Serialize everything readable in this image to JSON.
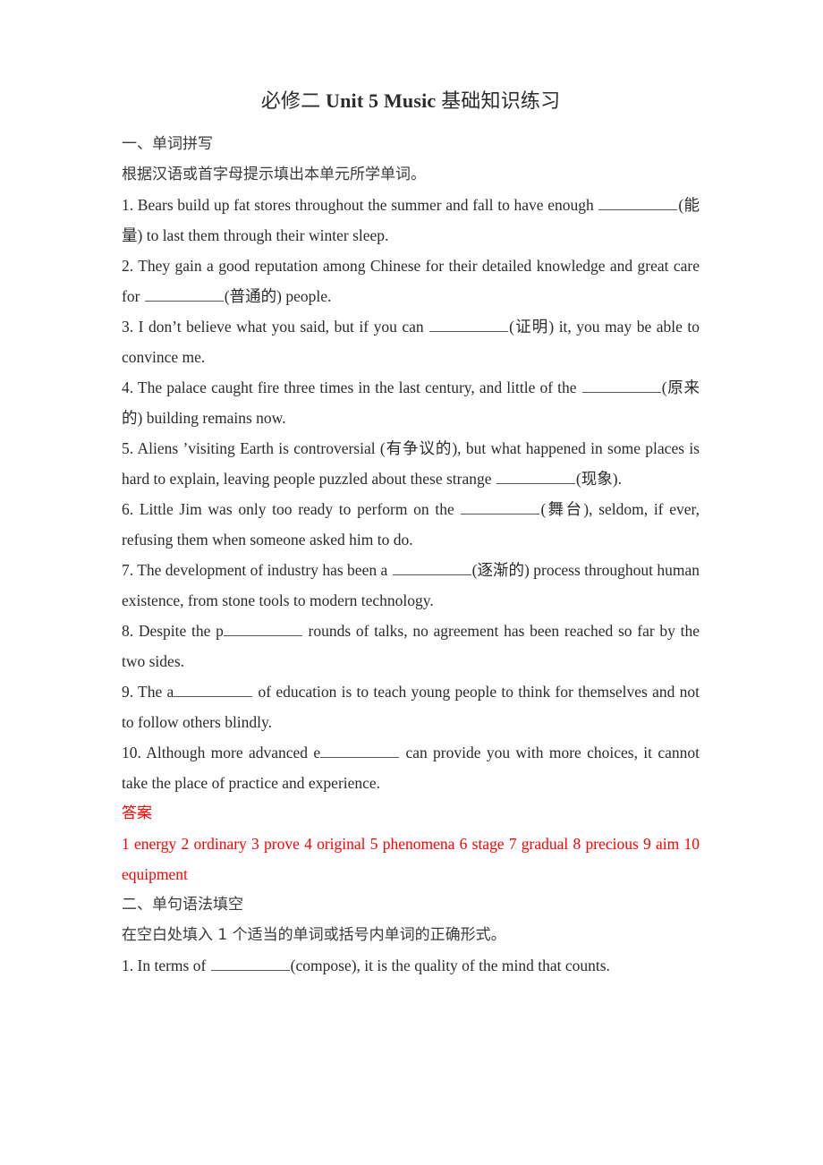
{
  "document": {
    "title": {
      "cn_prefix": "必修二 ",
      "en_bold": "Unit 5 Music",
      "cn_suffix": " 基础知识练习"
    },
    "colors": {
      "text": "#2b2b2b",
      "answer_red": "#FF0000"
    }
  },
  "section_one": {
    "heading": "一、单词拼写",
    "instruction": "根据汉语或首字母提示填出本单元所学单词。",
    "questions": [
      {
        "number": "1.",
        "pre": " Bears build up fat stores throughout the summer and fall to have enough ",
        "hint": "(能量)",
        "post": " to last them through their winter sleep."
      },
      {
        "number": "2.",
        "pre": " They gain a good reputation among Chinese for their detailed knowledge and great care for ",
        "hint": "(普通的)",
        "post": " people."
      },
      {
        "number": "3.",
        "pre": " I don’t believe what you said, but if you can ",
        "hint": "(证明)",
        "post": " it, you may be able to convince me."
      },
      {
        "number": "4.",
        "pre": " The palace caught fire three times in the last century, and little of the ",
        "hint": "(原来的)",
        "post": " building remains now."
      },
      {
        "number": "5.",
        "pre": " Aliens ’visiting Earth is controversial (有争议的), but what happened in some places is hard to explain, leaving people puzzled about these strange ",
        "hint": "(现象)",
        "post": "."
      },
      {
        "number": "6.",
        "pre": " Little Jim was only too ready to perform on the ",
        "hint": "(舞台)",
        "post": ", seldom, if ever, refusing them when someone asked him to do."
      },
      {
        "number": "7.",
        "pre": " The development of industry has been a ",
        "hint": "(逐渐的)",
        "post": " process throughout human existence, from stone tools to modern technology."
      },
      {
        "number": "8.",
        "pre": " Despite the p",
        "hint": "",
        "post": " rounds of talks, no agreement has been reached so far by the two sides."
      },
      {
        "number": "9.",
        "pre": " The a",
        "hint": "",
        "post": " of education is to teach young people to think for themselves and not to follow others blindly."
      },
      {
        "number": "10.",
        "pre": " Although more advanced e",
        "hint": "",
        "post": " can provide you with more choices, it cannot take the place of practice and experience."
      }
    ],
    "answers": {
      "label": "答案",
      "text": "1 energy 2 ordinary 3 prove 4 original 5 phenomena 6 stage 7 gradual 8 precious 9 aim 10 equipment"
    }
  },
  "section_two": {
    "heading": "二、单句语法填空",
    "instruction": "在空白处填入 1 个适当的单词或括号内单词的正确形式。",
    "questions": [
      {
        "number": "1.",
        "pre": " In terms of ",
        "hint": "(compose)",
        "post": ", it is the quality of the mind that counts."
      }
    ]
  }
}
